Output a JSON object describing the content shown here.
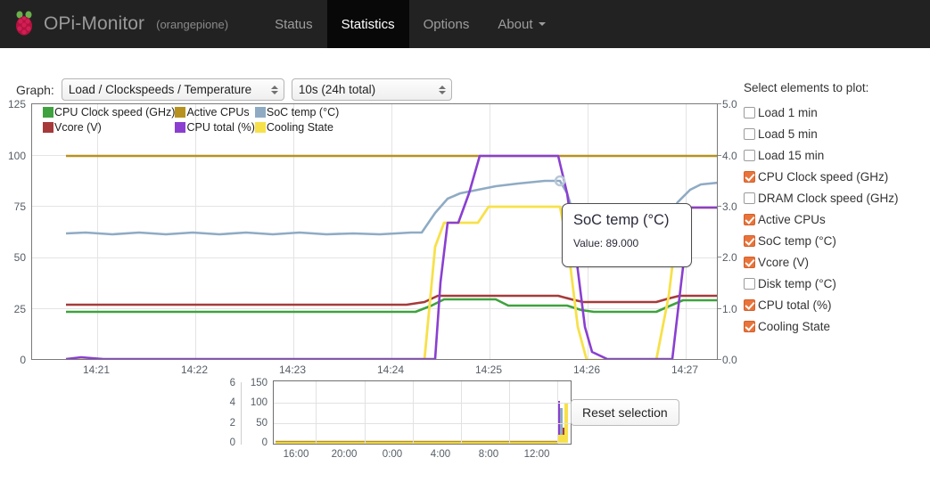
{
  "navbar": {
    "brand": "OPi-Monitor",
    "brand_sub": "(orangepione)",
    "logo_icon": "raspberry-pi-icon",
    "items": [
      {
        "label": "Status",
        "active": false,
        "caret": false
      },
      {
        "label": "Statistics",
        "active": true,
        "caret": false
      },
      {
        "label": "Options",
        "active": false,
        "caret": false
      },
      {
        "label": "About",
        "active": false,
        "caret": true
      }
    ]
  },
  "controls": {
    "graph_label": "Graph:",
    "graph_select_value": "Load / Clockspeeds / Temperature",
    "interval_select_value": "10s (24h total)"
  },
  "tooltip": {
    "title": "SoC temp (°C)",
    "value_text": "Value: 89.000"
  },
  "mini": {
    "reset_label": "Reset selection"
  },
  "side_panel": {
    "title": "Select elements to plot:",
    "items": [
      {
        "label": "Load 1 min",
        "checked": false
      },
      {
        "label": "Load 5 min",
        "checked": false
      },
      {
        "label": "Load 15 min",
        "checked": false
      },
      {
        "label": "CPU Clock speed (GHz)",
        "checked": true
      },
      {
        "label": "DRAM Clock speed (GHz)",
        "checked": false
      },
      {
        "label": "Active CPUs",
        "checked": true
      },
      {
        "label": "SoC temp (°C)",
        "checked": true
      },
      {
        "label": "Vcore (V)",
        "checked": true
      },
      {
        "label": "Disk temp (°C)",
        "checked": false
      },
      {
        "label": "CPU total (%)",
        "checked": true
      },
      {
        "label": "Cooling State",
        "checked": true
      }
    ]
  },
  "colors": {
    "cpu_clock": "#3fa23f",
    "active_cpus": "#b7921f",
    "soc_temp": "#8fabc4",
    "vcore": "#a63a3a",
    "cpu_total": "#8a3fd1",
    "cooling_state": "#f7e14a",
    "checkbox_checked": "#e8743b",
    "navbar_bg": "#222222",
    "navbar_active_bg": "#080808"
  },
  "chart_data": {
    "type": "line",
    "title": "",
    "xlabel": "",
    "ylabel": "",
    "legend_position": "top-left",
    "grid": true,
    "xticks": [
      "14:21",
      "14:22",
      "14:23",
      "14:24",
      "14:25",
      "14:26",
      "14:27"
    ],
    "y_left_ticks": [
      0,
      25,
      50,
      75,
      100,
      125
    ],
    "y_right_ticks": [
      "0.0",
      "1.0",
      "2.0",
      "3.0",
      "4.0",
      "5.0"
    ],
    "ylim_left": [
      0,
      125
    ],
    "ylim_right": [
      0.0,
      5.0
    ],
    "x": [
      0,
      1,
      2,
      3,
      4,
      5,
      6,
      7,
      8,
      9,
      10,
      11,
      12,
      13,
      14,
      15,
      16,
      17,
      18,
      19,
      20,
      21,
      22,
      23,
      24,
      25,
      26,
      27,
      28,
      29,
      30,
      31,
      32,
      33,
      34,
      35,
      36,
      37,
      38,
      39
    ],
    "series": [
      {
        "name": "CPU Clock speed (GHz)",
        "color": "#3fa23f",
        "axis": "right",
        "values": [
          0.96,
          0.96,
          0.96,
          0.96,
          0.96,
          0.96,
          0.96,
          0.96,
          0.96,
          0.96,
          0.96,
          0.96,
          0.96,
          0.96,
          0.96,
          0.96,
          0.96,
          0.96,
          0.96,
          0.96,
          0.96,
          1.2,
          1.34,
          1.34,
          1.34,
          1.2,
          1.2,
          1.2,
          1.2,
          1.2,
          1.2,
          0.96,
          0.96,
          0.96,
          0.96,
          0.96,
          1.2,
          1.3,
          1.3,
          1.3
        ]
      },
      {
        "name": "DRAM Clock speed (GHz)",
        "color": "#999999",
        "axis": "right",
        "plotted": false,
        "values": []
      },
      {
        "name": "Active CPUs",
        "color": "#b7921f",
        "axis": "right",
        "values": [
          4,
          4,
          4,
          4,
          4,
          4,
          4,
          4,
          4,
          4,
          4,
          4,
          4,
          4,
          4,
          4,
          4,
          4,
          4,
          4,
          4,
          4,
          4,
          4,
          4,
          4,
          4,
          4,
          4,
          4,
          4,
          4,
          4,
          4,
          4,
          4,
          4,
          4,
          4,
          4
        ]
      },
      {
        "name": "SoC temp (°C)",
        "color": "#8fabc4",
        "axis": "left",
        "values": [
          62,
          62,
          62,
          62,
          62,
          63,
          62,
          62,
          62,
          63,
          62,
          62,
          62,
          63,
          62,
          62,
          62,
          63,
          62,
          62,
          62,
          72,
          80,
          84,
          86,
          87,
          88,
          89,
          89,
          76,
          64,
          62,
          62,
          62,
          62,
          63,
          75,
          84,
          88,
          89
        ]
      },
      {
        "name": "Vcore (V)",
        "color": "#a63a3a",
        "axis": "right",
        "values": [
          1.1,
          1.1,
          1.1,
          1.1,
          1.1,
          1.1,
          1.1,
          1.1,
          1.1,
          1.1,
          1.1,
          1.1,
          1.1,
          1.1,
          1.1,
          1.1,
          1.1,
          1.1,
          1.1,
          1.1,
          1.1,
          1.2,
          1.26,
          1.26,
          1.26,
          1.26,
          1.26,
          1.26,
          1.26,
          1.12,
          1.1,
          1.1,
          1.1,
          1.1,
          1.1,
          1.1,
          1.2,
          1.26,
          1.26,
          1.26
        ]
      },
      {
        "name": "Disk temp (°C)",
        "color": "#777777",
        "axis": "left",
        "plotted": false,
        "values": []
      },
      {
        "name": "CPU total (%)",
        "color": "#8a3fd1",
        "axis": "left",
        "values": [
          1,
          1,
          1,
          1,
          1,
          1,
          1,
          1,
          1,
          1,
          1,
          1,
          1,
          1,
          1,
          1,
          1,
          1,
          1,
          1,
          0,
          0,
          67,
          100,
          100,
          100,
          100,
          100,
          100,
          20,
          2,
          2,
          2,
          2,
          2,
          2,
          2,
          75,
          75,
          75
        ]
      },
      {
        "name": "Cooling State",
        "color": "#f7e14a",
        "axis": "left",
        "values": [
          0,
          0,
          0,
          0,
          0,
          0,
          0,
          0,
          0,
          0,
          0,
          0,
          0,
          0,
          0,
          0,
          0,
          0,
          0,
          0,
          0,
          67,
          68,
          75,
          75,
          75,
          75,
          75,
          75,
          8,
          0,
          0,
          0,
          0,
          0,
          0,
          0,
          72,
          75,
          75
        ]
      }
    ],
    "annotations": [
      {
        "type": "tooltip",
        "label": "SoC temp (°C)",
        "text": "Value: 89.000",
        "value": 89.0
      }
    ],
    "overview_chart": {
      "type": "line",
      "xticks": [
        "16:00",
        "20:00",
        "0:00",
        "4:00",
        "8:00",
        "12:00"
      ],
      "y_outer_ticks": [
        0,
        2,
        4,
        6
      ],
      "y_inner_ticks": [
        0,
        50,
        100,
        150
      ],
      "ylim_outer": [
        0,
        6
      ],
      "ylim_inner": [
        0,
        150
      ],
      "note": "flat near zero across full 24h with activity spike at right edge"
    }
  }
}
